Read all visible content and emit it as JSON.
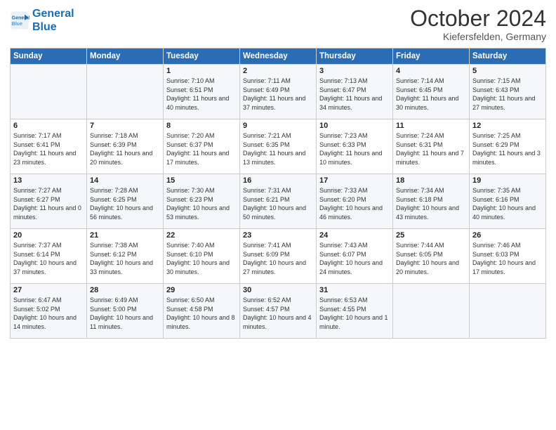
{
  "header": {
    "logo_line1": "General",
    "logo_line2": "Blue",
    "month": "October 2024",
    "location": "Kiefersfelden, Germany"
  },
  "days_of_week": [
    "Sunday",
    "Monday",
    "Tuesday",
    "Wednesday",
    "Thursday",
    "Friday",
    "Saturday"
  ],
  "weeks": [
    [
      {
        "day": "",
        "info": ""
      },
      {
        "day": "",
        "info": ""
      },
      {
        "day": "1",
        "info": "Sunrise: 7:10 AM\nSunset: 6:51 PM\nDaylight: 11 hours and 40 minutes."
      },
      {
        "day": "2",
        "info": "Sunrise: 7:11 AM\nSunset: 6:49 PM\nDaylight: 11 hours and 37 minutes."
      },
      {
        "day": "3",
        "info": "Sunrise: 7:13 AM\nSunset: 6:47 PM\nDaylight: 11 hours and 34 minutes."
      },
      {
        "day": "4",
        "info": "Sunrise: 7:14 AM\nSunset: 6:45 PM\nDaylight: 11 hours and 30 minutes."
      },
      {
        "day": "5",
        "info": "Sunrise: 7:15 AM\nSunset: 6:43 PM\nDaylight: 11 hours and 27 minutes."
      }
    ],
    [
      {
        "day": "6",
        "info": "Sunrise: 7:17 AM\nSunset: 6:41 PM\nDaylight: 11 hours and 23 minutes."
      },
      {
        "day": "7",
        "info": "Sunrise: 7:18 AM\nSunset: 6:39 PM\nDaylight: 11 hours and 20 minutes."
      },
      {
        "day": "8",
        "info": "Sunrise: 7:20 AM\nSunset: 6:37 PM\nDaylight: 11 hours and 17 minutes."
      },
      {
        "day": "9",
        "info": "Sunrise: 7:21 AM\nSunset: 6:35 PM\nDaylight: 11 hours and 13 minutes."
      },
      {
        "day": "10",
        "info": "Sunrise: 7:23 AM\nSunset: 6:33 PM\nDaylight: 11 hours and 10 minutes."
      },
      {
        "day": "11",
        "info": "Sunrise: 7:24 AM\nSunset: 6:31 PM\nDaylight: 11 hours and 7 minutes."
      },
      {
        "day": "12",
        "info": "Sunrise: 7:25 AM\nSunset: 6:29 PM\nDaylight: 11 hours and 3 minutes."
      }
    ],
    [
      {
        "day": "13",
        "info": "Sunrise: 7:27 AM\nSunset: 6:27 PM\nDaylight: 11 hours and 0 minutes."
      },
      {
        "day": "14",
        "info": "Sunrise: 7:28 AM\nSunset: 6:25 PM\nDaylight: 10 hours and 56 minutes."
      },
      {
        "day": "15",
        "info": "Sunrise: 7:30 AM\nSunset: 6:23 PM\nDaylight: 10 hours and 53 minutes."
      },
      {
        "day": "16",
        "info": "Sunrise: 7:31 AM\nSunset: 6:21 PM\nDaylight: 10 hours and 50 minutes."
      },
      {
        "day": "17",
        "info": "Sunrise: 7:33 AM\nSunset: 6:20 PM\nDaylight: 10 hours and 46 minutes."
      },
      {
        "day": "18",
        "info": "Sunrise: 7:34 AM\nSunset: 6:18 PM\nDaylight: 10 hours and 43 minutes."
      },
      {
        "day": "19",
        "info": "Sunrise: 7:35 AM\nSunset: 6:16 PM\nDaylight: 10 hours and 40 minutes."
      }
    ],
    [
      {
        "day": "20",
        "info": "Sunrise: 7:37 AM\nSunset: 6:14 PM\nDaylight: 10 hours and 37 minutes."
      },
      {
        "day": "21",
        "info": "Sunrise: 7:38 AM\nSunset: 6:12 PM\nDaylight: 10 hours and 33 minutes."
      },
      {
        "day": "22",
        "info": "Sunrise: 7:40 AM\nSunset: 6:10 PM\nDaylight: 10 hours and 30 minutes."
      },
      {
        "day": "23",
        "info": "Sunrise: 7:41 AM\nSunset: 6:09 PM\nDaylight: 10 hours and 27 minutes."
      },
      {
        "day": "24",
        "info": "Sunrise: 7:43 AM\nSunset: 6:07 PM\nDaylight: 10 hours and 24 minutes."
      },
      {
        "day": "25",
        "info": "Sunrise: 7:44 AM\nSunset: 6:05 PM\nDaylight: 10 hours and 20 minutes."
      },
      {
        "day": "26",
        "info": "Sunrise: 7:46 AM\nSunset: 6:03 PM\nDaylight: 10 hours and 17 minutes."
      }
    ],
    [
      {
        "day": "27",
        "info": "Sunrise: 6:47 AM\nSunset: 5:02 PM\nDaylight: 10 hours and 14 minutes."
      },
      {
        "day": "28",
        "info": "Sunrise: 6:49 AM\nSunset: 5:00 PM\nDaylight: 10 hours and 11 minutes."
      },
      {
        "day": "29",
        "info": "Sunrise: 6:50 AM\nSunset: 4:58 PM\nDaylight: 10 hours and 8 minutes."
      },
      {
        "day": "30",
        "info": "Sunrise: 6:52 AM\nSunset: 4:57 PM\nDaylight: 10 hours and 4 minutes."
      },
      {
        "day": "31",
        "info": "Sunrise: 6:53 AM\nSunset: 4:55 PM\nDaylight: 10 hours and 1 minute."
      },
      {
        "day": "",
        "info": ""
      },
      {
        "day": "",
        "info": ""
      }
    ]
  ]
}
